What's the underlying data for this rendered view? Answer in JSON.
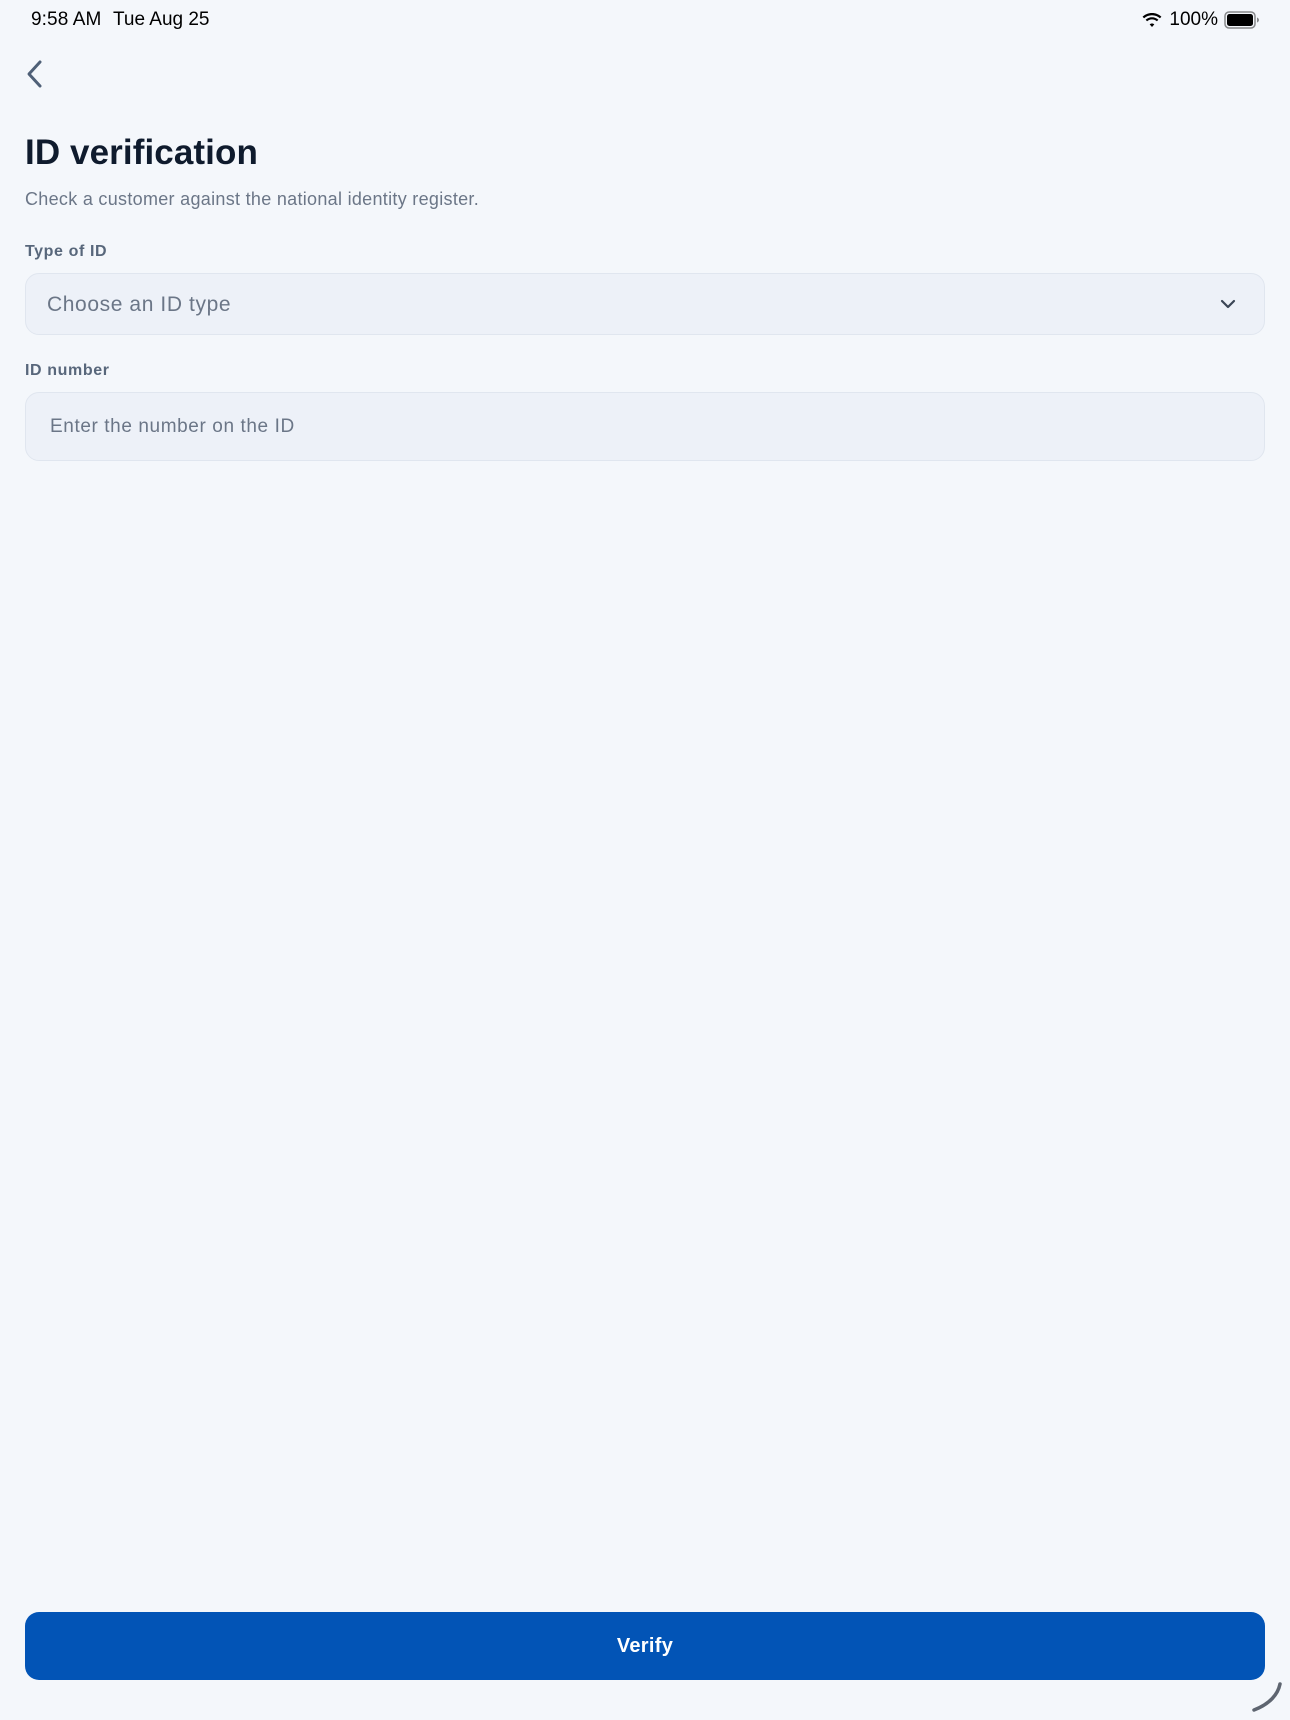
{
  "status_bar": {
    "time": "9:58 AM",
    "date": "Tue Aug 25",
    "battery_percent": "100%",
    "wifi_icon": "wifi-icon",
    "battery_icon": "battery-full-icon"
  },
  "navigation": {
    "back_icon": "chevron-left-icon"
  },
  "header": {
    "title": "ID verification",
    "subtitle": "Check a customer against the national identity register."
  },
  "form": {
    "id_type": {
      "label": "Type of ID",
      "placeholder": "Choose an ID type",
      "icon": "chevron-down-icon"
    },
    "id_number": {
      "label": "ID number",
      "placeholder": "Enter the number on the ID",
      "value": ""
    }
  },
  "actions": {
    "verify_label": "Verify"
  },
  "colors": {
    "background": "#f4f7fb",
    "primary": "#0254b6",
    "field_background": "#edf1f8",
    "title_text": "#0f1b2d",
    "muted_text": "#6b7687"
  }
}
